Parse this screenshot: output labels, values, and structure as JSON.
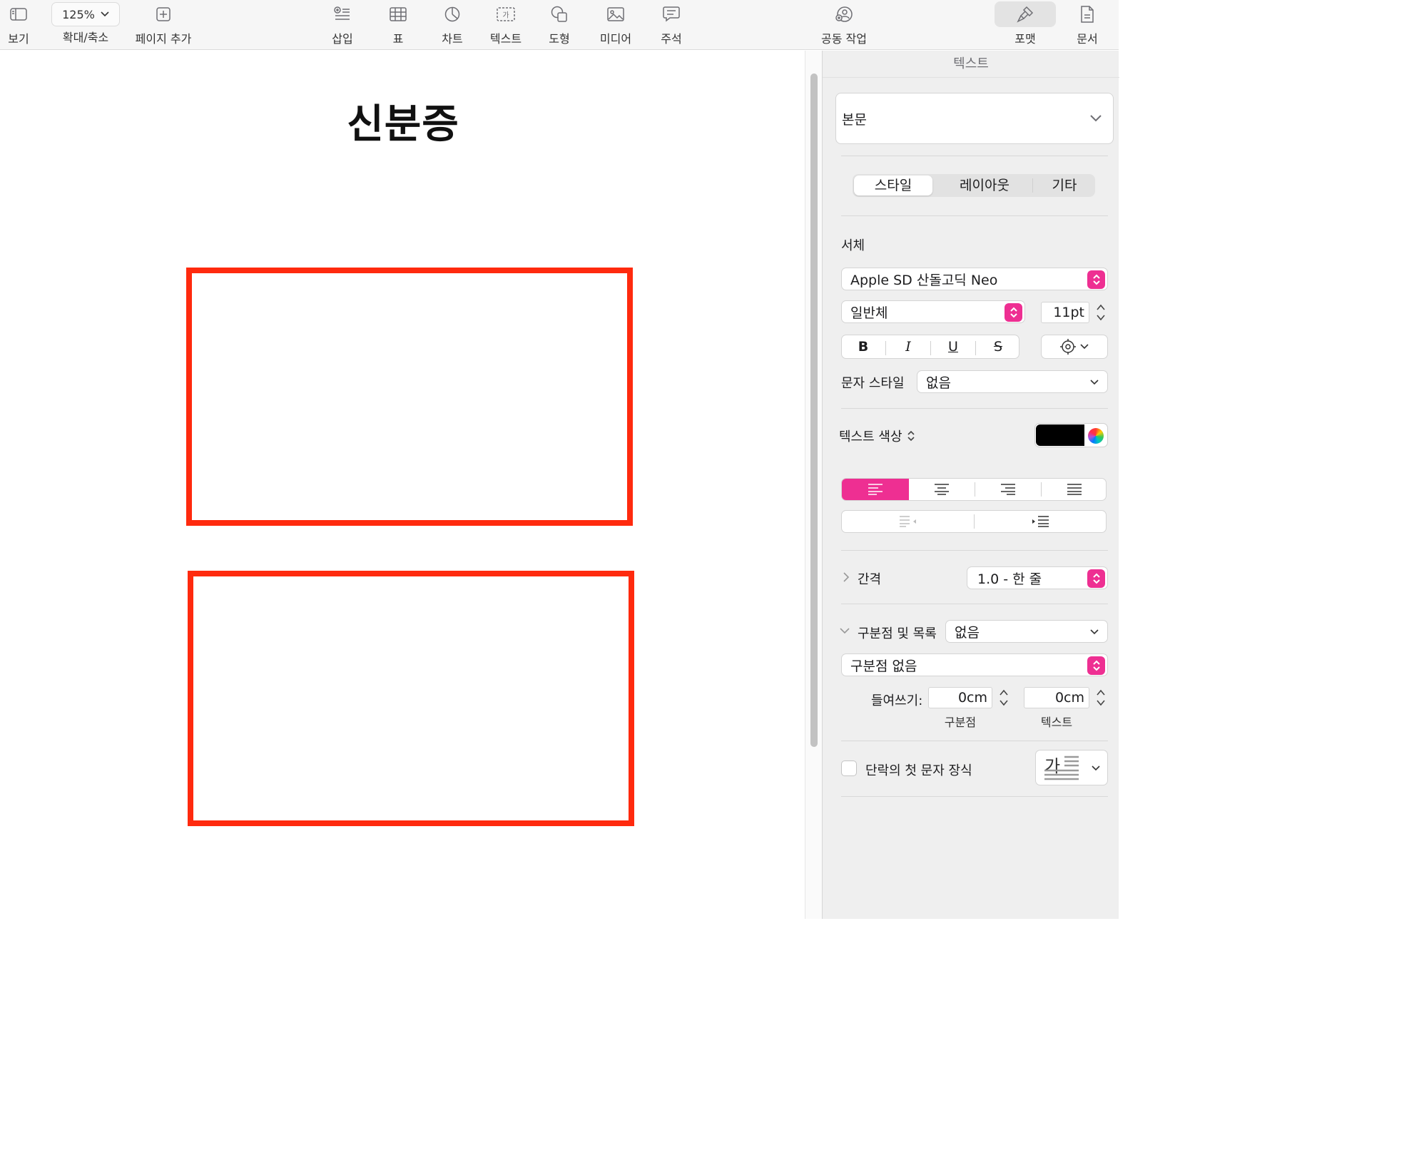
{
  "toolbar": {
    "view": "보기",
    "zoom_value": "125%",
    "zoom": "확대/축소",
    "add_page": "페이지 추가",
    "insert": "삽입",
    "table": "표",
    "chart": "차트",
    "text": "텍스트",
    "text_icon_glyph": "가",
    "shape": "도형",
    "media": "미디어",
    "comment": "주석",
    "collaborate": "공동 작업",
    "format": "포맷",
    "document": "문서"
  },
  "document": {
    "title": "신분증",
    "box_color": "#ff2a0e"
  },
  "inspector": {
    "header": "텍스트",
    "paragraph_style": "본문",
    "tabs": [
      "스타일",
      "레이아웃",
      "기타"
    ],
    "active_tab": "스타일",
    "font_label": "서체",
    "font_family": "Apple SD 산돌고딕 Neo",
    "font_weight": "일반체",
    "font_size": "11pt",
    "bold": "B",
    "italic": "I",
    "underline": "U",
    "strike": "S",
    "char_style_label": "문자 스타일",
    "char_style_value": "없음",
    "text_color_label": "텍스트 색상",
    "text_color": "#000000",
    "accent_color": "#ee2f92",
    "spacing_label": "간격",
    "spacing_value": "1.0 - 한 줄",
    "bullets_label": "구분점 및 목록",
    "bullets_value": "없음",
    "bullet_type": "구분점 없음",
    "indent_label": "들여쓰기:",
    "indent_bullet_value": "0cm",
    "indent_bullet_caption": "구분점",
    "indent_text_value": "0cm",
    "indent_text_caption": "텍스트",
    "dropcap_label": "단락의 첫 문자 장식",
    "dropcap_glyph": "가"
  }
}
